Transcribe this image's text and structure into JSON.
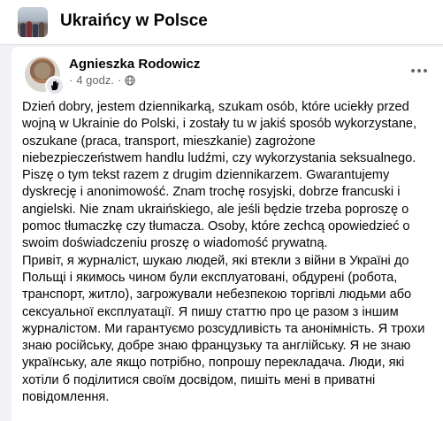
{
  "group": {
    "name": "Ukraińcy w Polsce"
  },
  "post": {
    "author": "Agnieszka Rodowicz",
    "separator": "·",
    "time": "4 godz.",
    "paragraph_pl": "Dzień dobry, jestem dziennikarką, szukam osób, które uciekły przed\nwojną w Ukrainie do Polski, i zostały tu w jakiś sposób wykorzystane,\noszukane (praca, transport, mieszkanie) zagrożone\nniebezpieczeństwem handlu ludźmi, czy wykorzystania seksualnego.\nPiszę o tym tekst razem z drugim dziennikarzem. Gwarantujemy\ndyskrecję i anonimowość. Znam trochę rosyjski, dobrze francuski i\nangielski. Nie znam ukraińskiego, ale jeśli będzie trzeba poproszę o\npomoc tłumaczkę czy tłumacza. Osoby, które zechcą opowiedzieć o\nswoim doświadczeniu proszę o wiadomość prywatną.",
    "paragraph_uk": "Привіт, я журналіст, шукаю людей, які втекли з війни в Україні до\nПольщі і якимось чином були експлуатовані, обдурені (робота,\nтранспорт, житло), загрожували небезпекою торгівлі людьми або\nсексуальної експлуатації. Я пишу статтю про це разом з іншим\nжурналістом. Ми гарантуємо розсудливість та анонімність. Я трохи\nзнаю російську, добре знаю французьку та англійську. Я не знаю\nукраїнську, але якщо потрібно, попрошу перекладача. Люди, які\nхотіли б поділитися своїм досвідом, пишіть мені в приватні\nповідомлення."
  },
  "icons": {
    "group_thumbnail": "group-photo",
    "avatar": "profile-photo",
    "badge": "waving-hand-icon",
    "audience": "globe-icon",
    "more": "more-options-icon"
  },
  "colors": {
    "background": "#f0f2f5",
    "card": "#ffffff",
    "secondary_text": "#65676b",
    "primary_text": "#050505"
  }
}
